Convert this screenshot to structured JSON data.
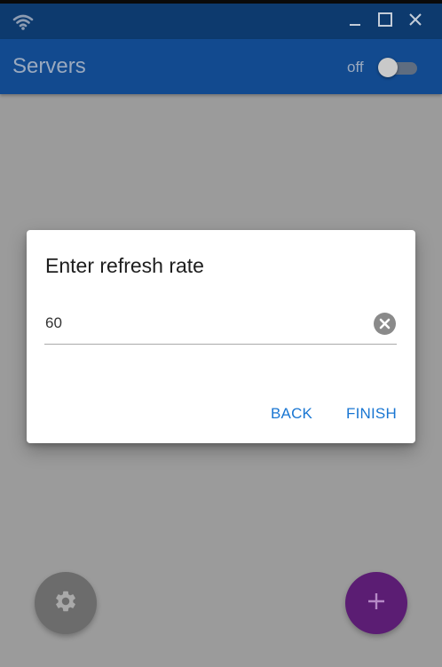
{
  "window": {
    "minimize_glyph": "_",
    "icons": {
      "app": "wifi-icon",
      "maximize": "maximize-icon",
      "close": "close-icon"
    }
  },
  "appbar": {
    "title": "Servers",
    "toggle_label": "off",
    "toggle_on": false
  },
  "dialog": {
    "title": "Enter refresh rate",
    "input_value": "60",
    "clear_icon": "clear-circle-icon",
    "back_label": "BACK",
    "finish_label": "FINISH"
  },
  "fabs": {
    "settings_icon": "gear-icon",
    "add_icon": "plus-icon"
  },
  "colors": {
    "titlebar": "#0d3a6e",
    "appbar": "#124a8f",
    "accent_button_text": "#1976d2",
    "add_fab": "#5b1d73",
    "settings_fab": "#6c6c6c",
    "scrim_background": "#9b9b9b"
  }
}
